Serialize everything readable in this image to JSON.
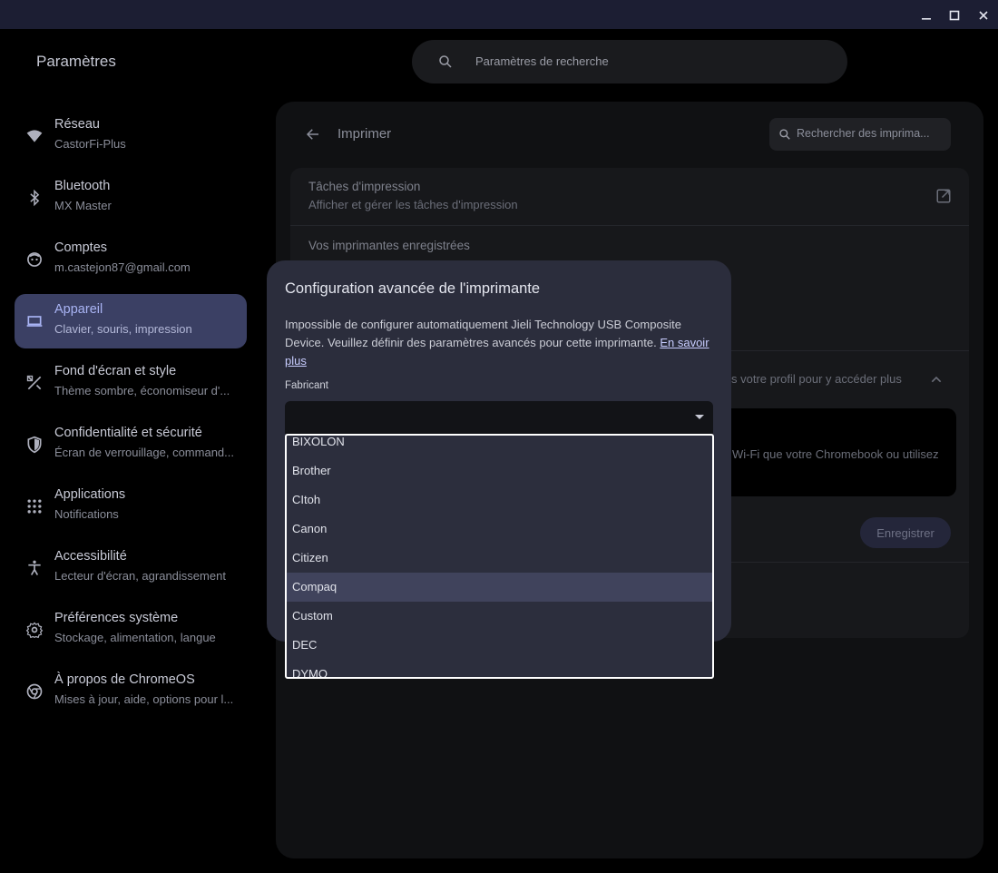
{
  "window": {
    "minimize": "minimize-icon",
    "maximize": "maximize-icon",
    "close": "close-icon"
  },
  "app": {
    "title": "Paramètres",
    "search_placeholder": "Paramètres de recherche"
  },
  "sidebar": {
    "items": [
      {
        "title": "Réseau",
        "sub": "CastorFi-Plus",
        "icon": "wifi-icon"
      },
      {
        "title": "Bluetooth",
        "sub": "MX Master",
        "icon": "bluetooth-icon"
      },
      {
        "title": "Comptes",
        "sub": "m.castejon87@gmail.com",
        "icon": "account-icon"
      },
      {
        "title": "Appareil",
        "sub": "Clavier, souris, impression",
        "icon": "laptop-icon",
        "active": true
      },
      {
        "title": "Fond d'écran et style",
        "sub": "Thème sombre, économiseur d'...",
        "icon": "palette-icon"
      },
      {
        "title": "Confidentialité et sécurité",
        "sub": "Écran de verrouillage, command...",
        "icon": "shield-icon"
      },
      {
        "title": "Applications",
        "sub": "Notifications",
        "icon": "apps-grid-icon"
      },
      {
        "title": "Accessibilité",
        "sub": "Lecteur d'écran, agrandissement",
        "icon": "accessibility-icon"
      },
      {
        "title": "Préférences système",
        "sub": "Stockage, alimentation, langue",
        "icon": "gear-icon"
      },
      {
        "title": "À propos de ChromeOS",
        "sub": "Mises à jour, aide, options pour l...",
        "icon": "chrome-icon"
      }
    ]
  },
  "page": {
    "title": "Imprimer",
    "printer_search_placeholder": "Rechercher des imprima...",
    "print_jobs": {
      "title": "Tâches d'impression",
      "sub": "Afficher et gérer les tâches d'impression"
    },
    "saved_printers": {
      "title": "Vos imprimantes enregistrées"
    },
    "profile_text": "s votre profil pour y accéder plus",
    "wifi_text": "Wi-Fi que votre Chromebook ou utilisez",
    "save_label": "Enregistrer"
  },
  "dialog": {
    "title": "Configuration avancée de l'imprimante",
    "body": "Impossible de configurer automatiquement Jieli Technology USB Composite Device. Veuillez définir des paramètres avancés pour cette imprimante.",
    "link": "En savoir plus",
    "manufacturer_label": "Fabricant",
    "manufacturer_value": "",
    "options": [
      "BIXOLON",
      "Brother",
      "CItoh",
      "Canon",
      "Citizen",
      "Compaq",
      "Custom",
      "DEC",
      "DYMO"
    ],
    "selected_option": "Compaq"
  },
  "colors": {
    "accent": "#a9b4f4",
    "active_nav_bg": "#3b4064",
    "dialog_bg": "#2b2d3c",
    "titlebar_bg": "#1c1e33"
  }
}
